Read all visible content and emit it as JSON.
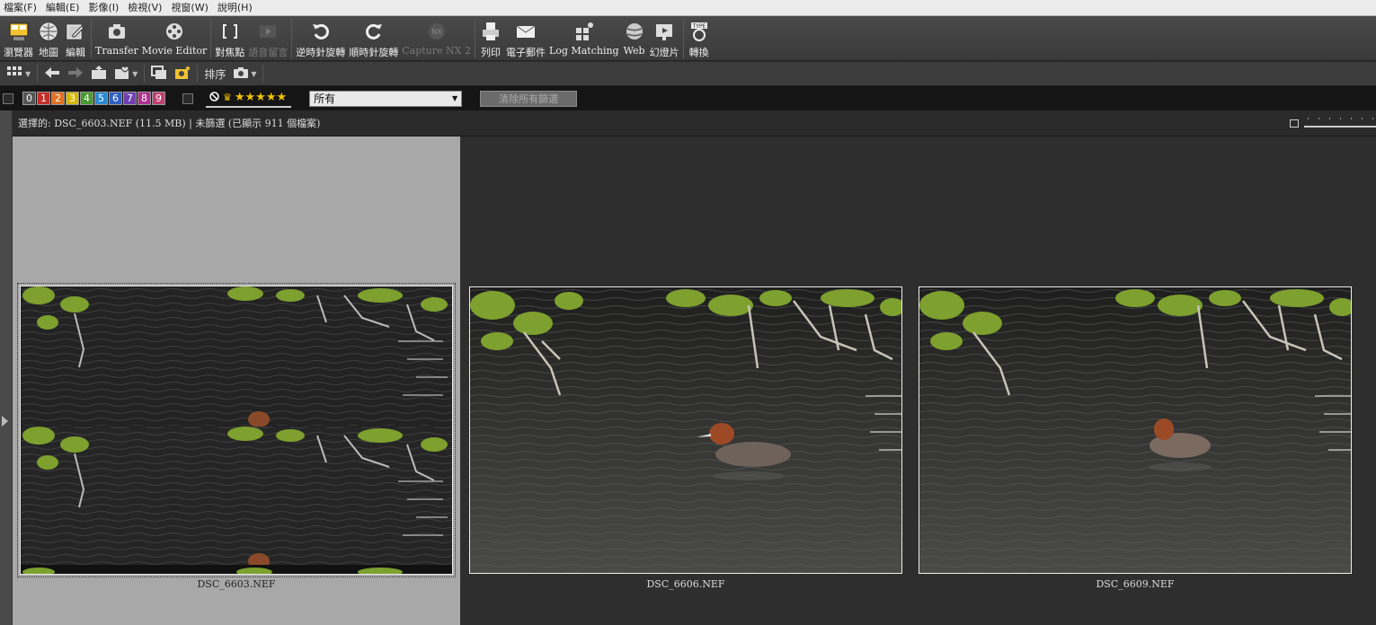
{
  "menu": [
    "檔案(F)",
    "編輯(E)",
    "影像(I)",
    "檢視(V)",
    "視窗(W)",
    "說明(H)"
  ],
  "toolbar": {
    "browser": "瀏覽器",
    "map": "地圖",
    "edit": "編輯",
    "transfer": "Transfer",
    "movie_editor": "Movie Editor",
    "focus_point": "對焦點",
    "voice_memo": "語音留言",
    "rotate_ccw": "逆時針旋轉",
    "rotate_cw": "順時針旋轉",
    "capture_nx2": "Capture NX 2",
    "print": "列印",
    "email": "電子郵件",
    "log_matching": "Log Matching",
    "web": "Web",
    "slideshow": "幻燈片",
    "convert": "轉換"
  },
  "toolbar2": {
    "sort_label": "排序"
  },
  "filter": {
    "labels": [
      "0",
      "1",
      "2",
      "3",
      "4",
      "5",
      "6",
      "7",
      "8",
      "9"
    ],
    "label_colors": [
      "#555555",
      "#c0302a",
      "#e07020",
      "#d6b800",
      "#4a9a30",
      "#2a8ad0",
      "#3060c0",
      "#7040b0",
      "#b03090",
      "#c04070"
    ],
    "rating_symbol": "★★★★★",
    "select_value": "所有",
    "clear_label": "清除所有篩選"
  },
  "status": {
    "text": "選擇的: DSC_6603.NEF (11.5 MB) | 未篩選  (已顯示 911 個檔案)"
  },
  "thumbnails": [
    {
      "name": "DSC_6603.NEF",
      "selected": true
    },
    {
      "name": "DSC_6606.NEF",
      "selected": false
    },
    {
      "name": "DSC_6609.NEF",
      "selected": false
    }
  ]
}
